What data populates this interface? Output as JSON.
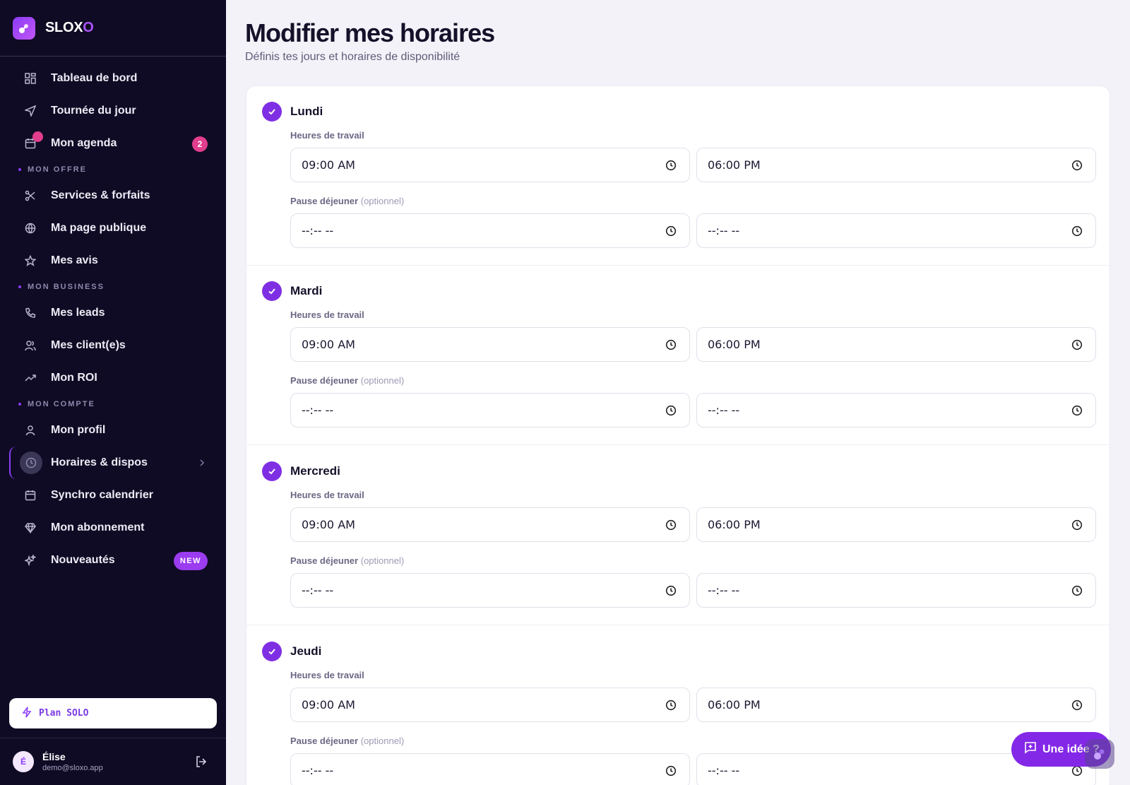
{
  "brand": {
    "name_main": "SLOX",
    "name_accent": "O"
  },
  "sidebar": {
    "items": [
      {
        "label": "Tableau de bord",
        "icon": "dashboard-icon"
      },
      {
        "label": "Tournée du jour",
        "icon": "navigation-icon"
      },
      {
        "label": "Mon agenda",
        "icon": "calendar-icon",
        "badge": "2"
      }
    ],
    "sections": [
      {
        "title": "MON OFFRE",
        "items": [
          {
            "label": "Services & forfaits",
            "icon": "scissors-icon"
          },
          {
            "label": "Ma page publique",
            "icon": "globe-icon"
          },
          {
            "label": "Mes avis",
            "icon": "star-icon"
          }
        ]
      },
      {
        "title": "MON BUSINESS",
        "items": [
          {
            "label": "Mes leads",
            "icon": "phone-icon"
          },
          {
            "label": "Mes client(e)s",
            "icon": "users-icon"
          },
          {
            "label": "Mon ROI",
            "icon": "trending-up-icon"
          }
        ]
      },
      {
        "title": "MON COMPTE",
        "items": [
          {
            "label": "Mon profil",
            "icon": "user-icon"
          },
          {
            "label": "Horaires & dispos",
            "icon": "clock-icon",
            "active": true
          },
          {
            "label": "Synchro calendrier",
            "icon": "calendar-icon"
          },
          {
            "label": "Mon abonnement",
            "icon": "diamond-icon"
          },
          {
            "label": "Nouveautés",
            "icon": "sparkles-icon",
            "tag": "NEW"
          }
        ]
      }
    ],
    "plan_label": "Plan SOLO",
    "user": {
      "initial": "É",
      "name": "Élise",
      "email": "demo@sloxo.app"
    }
  },
  "main": {
    "title": "Modifier mes horaires",
    "subtitle": "Définis tes jours et horaires de disponibilité",
    "work_label": "Heures de travail",
    "lunch_label": "Pause déjeuner",
    "lunch_optional": "(optionnel)",
    "days": [
      {
        "name": "Lundi",
        "work_start": "09:00 AM",
        "work_end": "06:00 PM",
        "lunch_start": "--:-- --",
        "lunch_end": "--:-- --"
      },
      {
        "name": "Mardi",
        "work_start": "09:00 AM",
        "work_end": "06:00 PM",
        "lunch_start": "--:-- --",
        "lunch_end": "--:-- --"
      },
      {
        "name": "Mercredi",
        "work_start": "09:00 AM",
        "work_end": "06:00 PM",
        "lunch_start": "--:-- --",
        "lunch_end": "--:-- --"
      },
      {
        "name": "Jeudi",
        "work_start": "09:00 AM",
        "work_end": "06:00 PM",
        "lunch_start": "--:-- --",
        "lunch_end": "--:-- --"
      }
    ]
  },
  "idea_button": "Une idée ?",
  "colors": {
    "accent": "#8b3cf7",
    "sidebar_bg": "#0f0b24",
    "badge": "#e23e8d"
  }
}
